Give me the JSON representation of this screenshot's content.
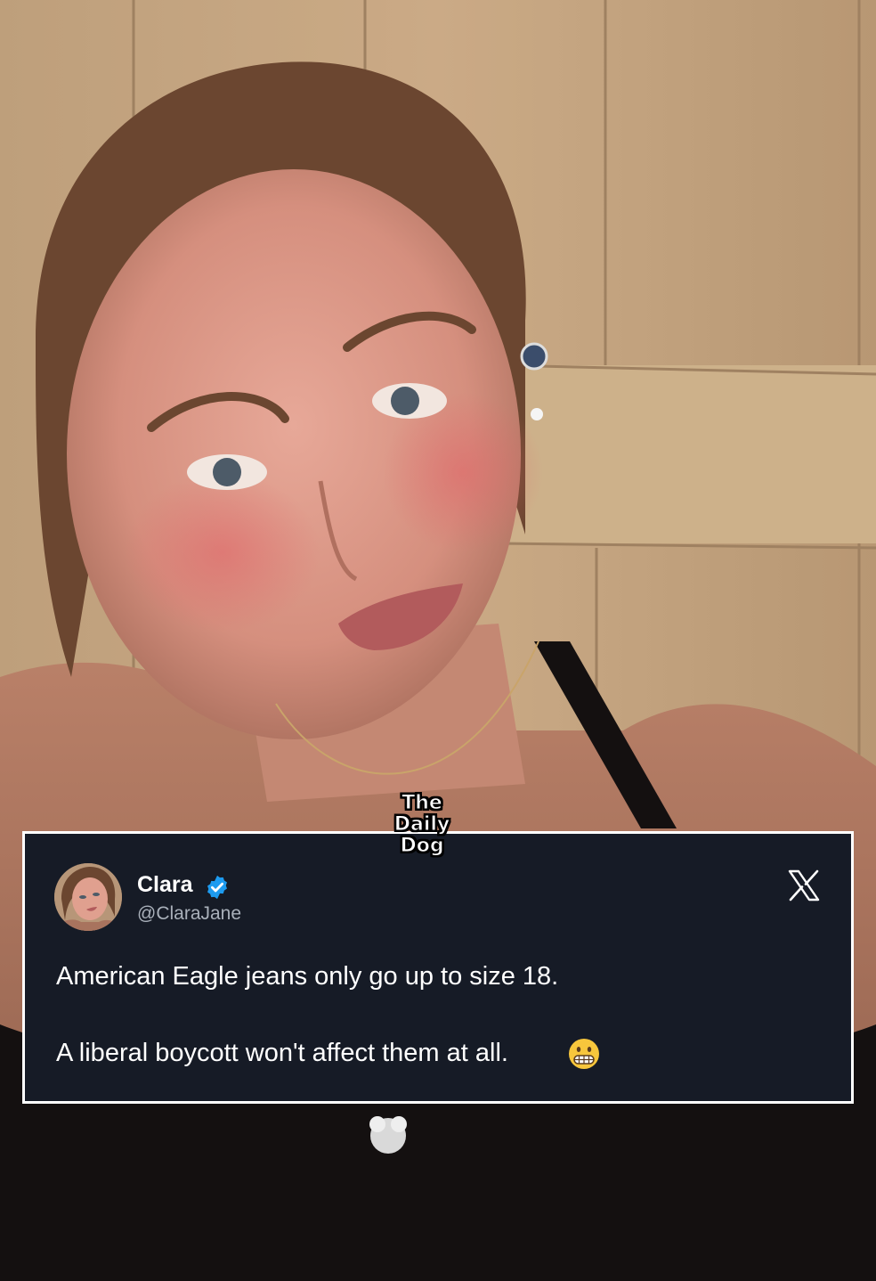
{
  "logo": {
    "line1": "The",
    "line2": "Daily",
    "line3": "Dog"
  },
  "tweet": {
    "display_name": "Clara",
    "handle": "@ClaraJane",
    "verified_icon": "verified-badge-icon",
    "platform_icon": "x-logo-icon",
    "line1": "American Eagle jeans only go up to size 18.",
    "line2": "A liberal boycott won't affect them at all.",
    "emoji": "grimacing-face-icon"
  },
  "colors": {
    "card_background": "#161b26",
    "card_border": "#ffffff",
    "verified_blue": "#1d9bf0",
    "handle_gray": "#a9b0ba",
    "emoji_yellow": "#f7c63c"
  }
}
